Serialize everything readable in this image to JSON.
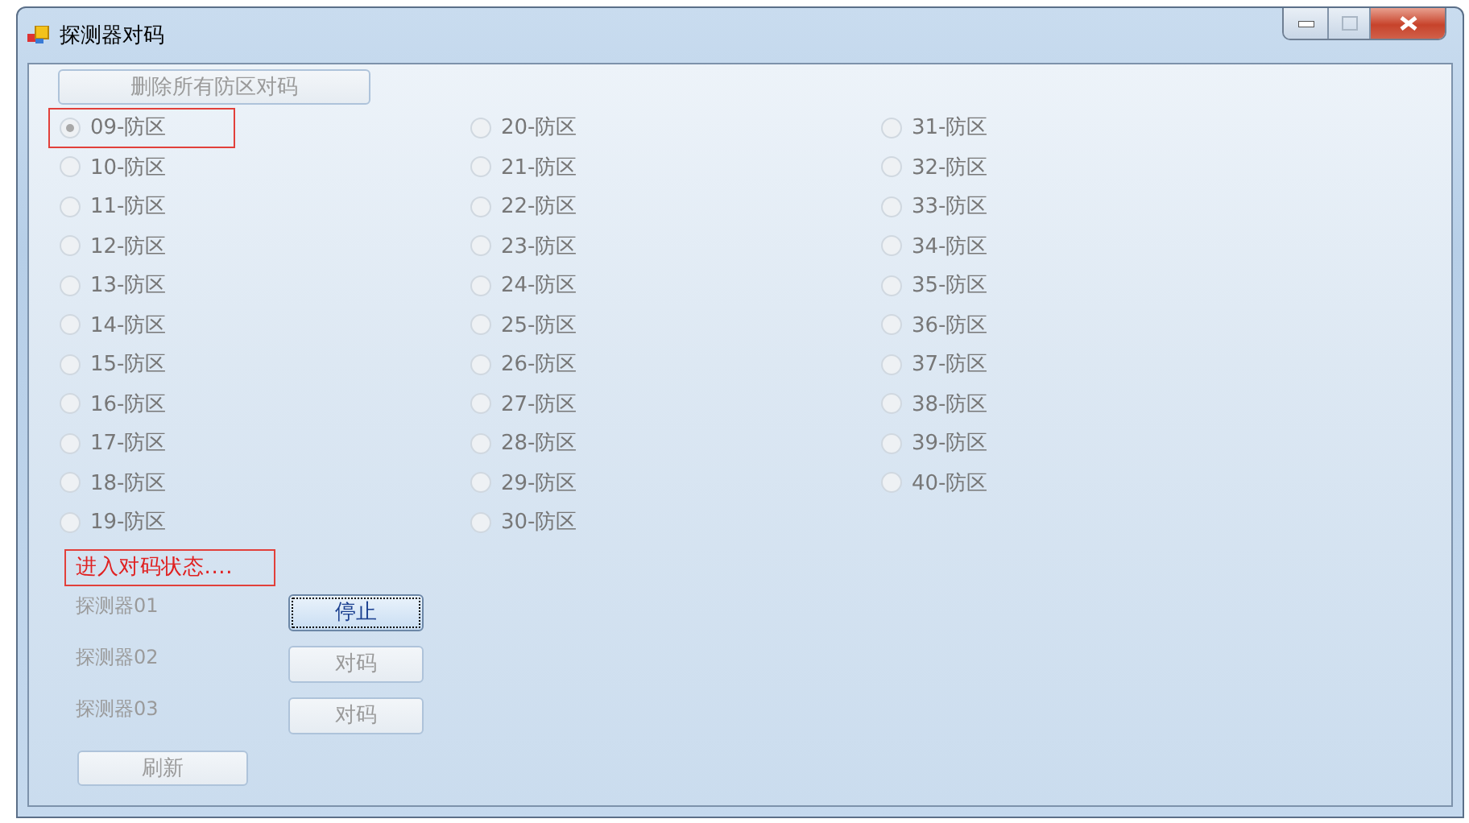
{
  "window": {
    "title": "探测器对码"
  },
  "delete_all_button": {
    "label": "删除所有防区对码",
    "disabled": true
  },
  "zone_columns": [
    [
      {
        "label": "09-防区",
        "selected": true,
        "outlined": true,
        "disabled": true
      },
      {
        "label": "10-防区",
        "selected": false,
        "outlined": false,
        "disabled": true
      },
      {
        "label": "11-防区",
        "selected": false,
        "outlined": false,
        "disabled": true
      },
      {
        "label": "12-防区",
        "selected": false,
        "outlined": false,
        "disabled": true
      },
      {
        "label": "13-防区",
        "selected": false,
        "outlined": false,
        "disabled": true
      },
      {
        "label": "14-防区",
        "selected": false,
        "outlined": false,
        "disabled": true
      },
      {
        "label": "15-防区",
        "selected": false,
        "outlined": false,
        "disabled": true
      },
      {
        "label": "16-防区",
        "selected": false,
        "outlined": false,
        "disabled": true
      },
      {
        "label": "17-防区",
        "selected": false,
        "outlined": false,
        "disabled": true
      },
      {
        "label": "18-防区",
        "selected": false,
        "outlined": false,
        "disabled": true
      },
      {
        "label": "19-防区",
        "selected": false,
        "outlined": false,
        "disabled": true
      }
    ],
    [
      {
        "label": "20-防区",
        "selected": false,
        "outlined": false,
        "disabled": true
      },
      {
        "label": "21-防区",
        "selected": false,
        "outlined": false,
        "disabled": true
      },
      {
        "label": "22-防区",
        "selected": false,
        "outlined": false,
        "disabled": true
      },
      {
        "label": "23-防区",
        "selected": false,
        "outlined": false,
        "disabled": true
      },
      {
        "label": "24-防区",
        "selected": false,
        "outlined": false,
        "disabled": true
      },
      {
        "label": "25-防区",
        "selected": false,
        "outlined": false,
        "disabled": true
      },
      {
        "label": "26-防区",
        "selected": false,
        "outlined": false,
        "disabled": true
      },
      {
        "label": "27-防区",
        "selected": false,
        "outlined": false,
        "disabled": true
      },
      {
        "label": "28-防区",
        "selected": false,
        "outlined": false,
        "disabled": true
      },
      {
        "label": "29-防区",
        "selected": false,
        "outlined": false,
        "disabled": true
      },
      {
        "label": "30-防区",
        "selected": false,
        "outlined": false,
        "disabled": true
      }
    ],
    [
      {
        "label": "31-防区",
        "selected": false,
        "outlined": false,
        "disabled": true
      },
      {
        "label": "32-防区",
        "selected": false,
        "outlined": false,
        "disabled": true
      },
      {
        "label": "33-防区",
        "selected": false,
        "outlined": false,
        "disabled": true
      },
      {
        "label": "34-防区",
        "selected": false,
        "outlined": false,
        "disabled": true
      },
      {
        "label": "35-防区",
        "selected": false,
        "outlined": false,
        "disabled": true
      },
      {
        "label": "36-防区",
        "selected": false,
        "outlined": false,
        "disabled": true
      },
      {
        "label": "37-防区",
        "selected": false,
        "outlined": false,
        "disabled": true
      },
      {
        "label": "38-防区",
        "selected": false,
        "outlined": false,
        "disabled": true
      },
      {
        "label": "39-防区",
        "selected": false,
        "outlined": false,
        "disabled": true
      },
      {
        "label": "40-防区",
        "selected": false,
        "outlined": false,
        "disabled": true
      }
    ]
  ],
  "status": {
    "text": "进入对码状态....",
    "outlined": true
  },
  "detectors": [
    {
      "label": "探测器01",
      "button": "停止",
      "disabled": false,
      "focused": true
    },
    {
      "label": "探测器02",
      "button": "对码",
      "disabled": true,
      "focused": false
    },
    {
      "label": "探测器03",
      "button": "对码",
      "disabled": true,
      "focused": false
    }
  ],
  "refresh_button": {
    "label": "刷新",
    "disabled": true
  }
}
